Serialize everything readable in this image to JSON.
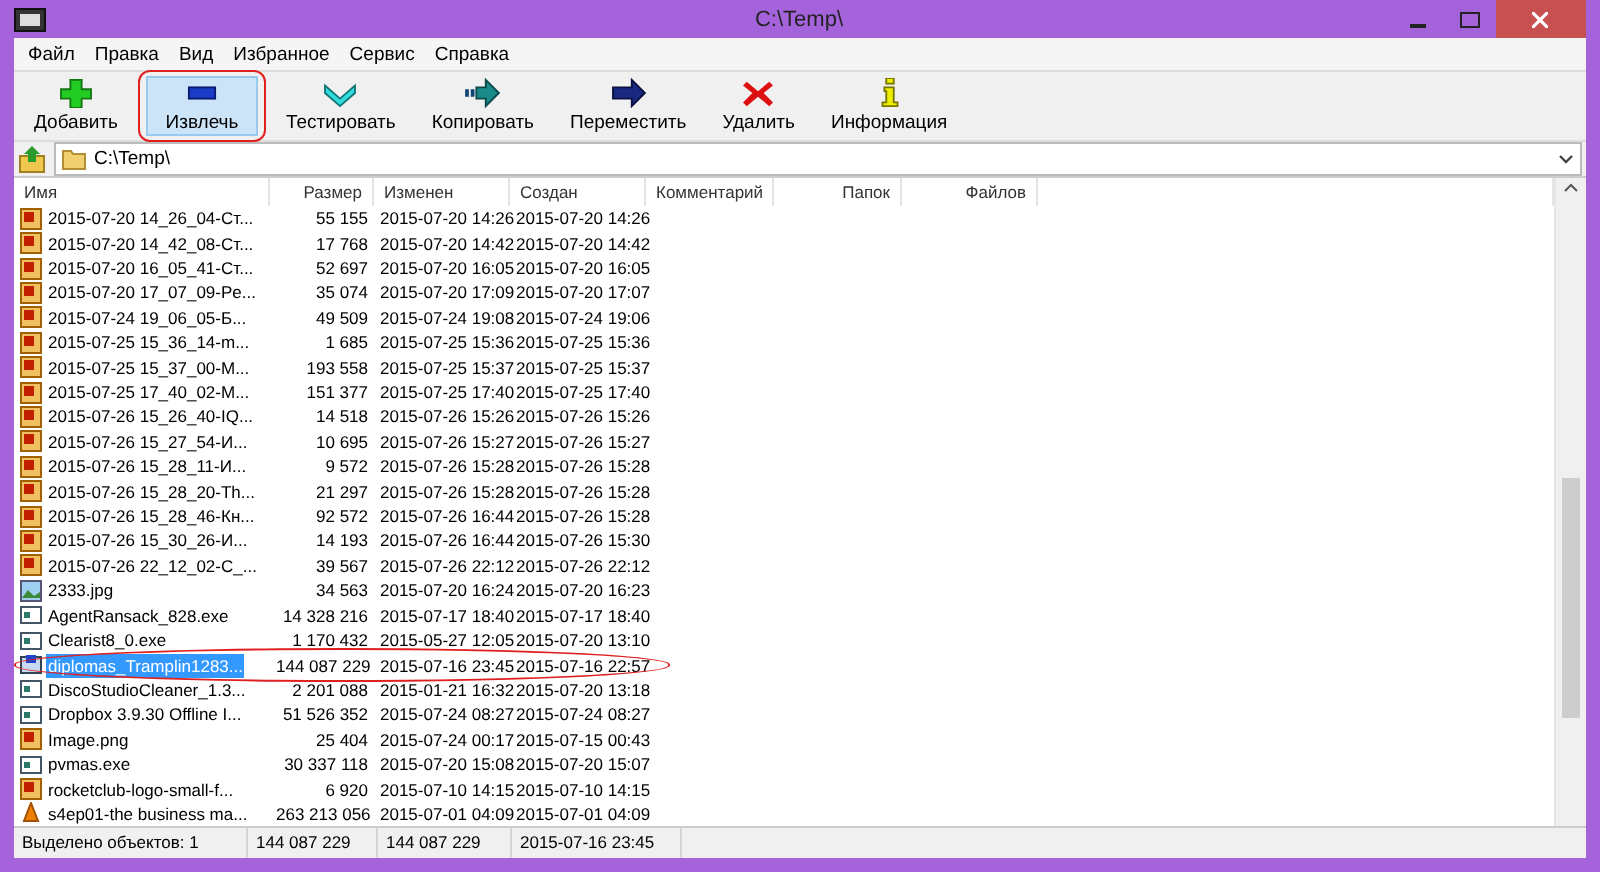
{
  "window": {
    "title": "C:\\Temp\\"
  },
  "menu": [
    "Файл",
    "Правка",
    "Вид",
    "Избранное",
    "Сервис",
    "Справка"
  ],
  "toolbar": [
    {
      "kind": "add",
      "label": "Добавить",
      "selected": false,
      "annotated": false
    },
    {
      "kind": "extract",
      "label": "Извлечь",
      "selected": true,
      "annotated": true
    },
    {
      "kind": "test",
      "label": "Тестировать",
      "selected": false,
      "annotated": false
    },
    {
      "kind": "copy",
      "label": "Копировать",
      "selected": false,
      "annotated": false
    },
    {
      "kind": "move",
      "label": "Переместить",
      "selected": false,
      "annotated": false
    },
    {
      "kind": "delete",
      "label": "Удалить",
      "selected": false,
      "annotated": false
    },
    {
      "kind": "info",
      "label": "Информация",
      "selected": false,
      "annotated": false
    }
  ],
  "address": {
    "value": "C:\\Temp\\"
  },
  "table": {
    "columns": [
      "Имя",
      "Размер",
      "Изменен",
      "Создан",
      "Комментарий",
      "Папок",
      "Файлов"
    ],
    "rows": [
      {
        "kind": "raster",
        "name": "2015-07-20 14_26_04-Ст...",
        "size": "55 155",
        "modified": "2015-07-20 14:26",
        "created": "2015-07-20 14:26",
        "selected": false,
        "annotated": false
      },
      {
        "kind": "raster",
        "name": "2015-07-20 14_42_08-Ст...",
        "size": "17 768",
        "modified": "2015-07-20 14:42",
        "created": "2015-07-20 14:42",
        "selected": false,
        "annotated": false
      },
      {
        "kind": "raster",
        "name": "2015-07-20 16_05_41-Ст...",
        "size": "52 697",
        "modified": "2015-07-20 16:05",
        "created": "2015-07-20 16:05",
        "selected": false,
        "annotated": false
      },
      {
        "kind": "raster",
        "name": "2015-07-20 17_07_09-Pe...",
        "size": "35 074",
        "modified": "2015-07-20 17:09",
        "created": "2015-07-20 17:07",
        "selected": false,
        "annotated": false
      },
      {
        "kind": "raster",
        "name": "2015-07-24 19_06_05-Б...",
        "size": "49 509",
        "modified": "2015-07-24 19:08",
        "created": "2015-07-24 19:06",
        "selected": false,
        "annotated": false
      },
      {
        "kind": "raster",
        "name": "2015-07-25 15_36_14-m...",
        "size": "1 685",
        "modified": "2015-07-25 15:36",
        "created": "2015-07-25 15:36",
        "selected": false,
        "annotated": false
      },
      {
        "kind": "raster",
        "name": "2015-07-25 15_37_00-M...",
        "size": "193 558",
        "modified": "2015-07-25 15:37",
        "created": "2015-07-25 15:37",
        "selected": false,
        "annotated": false
      },
      {
        "kind": "raster",
        "name": "2015-07-25 17_40_02-M...",
        "size": "151 377",
        "modified": "2015-07-25 17:40",
        "created": "2015-07-25 17:40",
        "selected": false,
        "annotated": false
      },
      {
        "kind": "raster",
        "name": "2015-07-26 15_26_40-IQ...",
        "size": "14 518",
        "modified": "2015-07-26 15:26",
        "created": "2015-07-26 15:26",
        "selected": false,
        "annotated": false
      },
      {
        "kind": "raster",
        "name": "2015-07-26 15_27_54-И...",
        "size": "10 695",
        "modified": "2015-07-26 15:27",
        "created": "2015-07-26 15:27",
        "selected": false,
        "annotated": false
      },
      {
        "kind": "raster",
        "name": "2015-07-26 15_28_11-И...",
        "size": "9 572",
        "modified": "2015-07-26 15:28",
        "created": "2015-07-26 15:28",
        "selected": false,
        "annotated": false
      },
      {
        "kind": "raster",
        "name": "2015-07-26 15_28_20-Th...",
        "size": "21 297",
        "modified": "2015-07-26 15:28",
        "created": "2015-07-26 15:28",
        "selected": false,
        "annotated": false
      },
      {
        "kind": "raster",
        "name": "2015-07-26 15_28_46-Кн...",
        "size": "92 572",
        "modified": "2015-07-26 16:44",
        "created": "2015-07-26 15:28",
        "selected": false,
        "annotated": false
      },
      {
        "kind": "raster",
        "name": "2015-07-26 15_30_26-И...",
        "size": "14 193",
        "modified": "2015-07-26 16:44",
        "created": "2015-07-26 15:30",
        "selected": false,
        "annotated": false
      },
      {
        "kind": "raster",
        "name": "2015-07-26 22_12_02-С_...",
        "size": "39 567",
        "modified": "2015-07-26 22:12",
        "created": "2015-07-26 22:12",
        "selected": false,
        "annotated": false
      },
      {
        "kind": "picture",
        "name": "2333.jpg",
        "size": "34 563",
        "modified": "2015-07-20 16:24",
        "created": "2015-07-20 16:23",
        "selected": false,
        "annotated": false
      },
      {
        "kind": "program",
        "name": "AgentRansack_828.exe",
        "size": "14 328 216",
        "modified": "2015-07-17 18:40",
        "created": "2015-07-17 18:40",
        "selected": false,
        "annotated": false
      },
      {
        "kind": "program",
        "name": "Clearist8_0.exe",
        "size": "1 170 432",
        "modified": "2015-05-27 12:05",
        "created": "2015-07-20 13:10",
        "selected": false,
        "annotated": false
      },
      {
        "kind": "archive",
        "name": "diplomas_Tramplin1283...",
        "size": "144 087 229",
        "modified": "2015-07-16 23:45",
        "created": "2015-07-16 22:57",
        "selected": true,
        "annotated": true
      },
      {
        "kind": "program",
        "name": "DiscoStudioCleaner_1.3...",
        "size": "2 201 088",
        "modified": "2015-01-21 16:32",
        "created": "2015-07-20 13:18",
        "selected": false,
        "annotated": false
      },
      {
        "kind": "program",
        "name": "Dropbox 3.9.30 Offline I...",
        "size": "51 526 352",
        "modified": "2015-07-24 08:27",
        "created": "2015-07-24 08:27",
        "selected": false,
        "annotated": false
      },
      {
        "kind": "raster",
        "name": "Image.png",
        "size": "25 404",
        "modified": "2015-07-24 00:17",
        "created": "2015-07-15 00:43",
        "selected": false,
        "annotated": false
      },
      {
        "kind": "program",
        "name": "pvmas.exe",
        "size": "30 337 118",
        "modified": "2015-07-20 15:08",
        "created": "2015-07-20 15:07",
        "selected": false,
        "annotated": false
      },
      {
        "kind": "raster",
        "name": "rocketclub-logo-small-f...",
        "size": "6 920",
        "modified": "2015-07-10 14:15",
        "created": "2015-07-10 14:15",
        "selected": false,
        "annotated": false
      },
      {
        "kind": "media",
        "name": "s4ep01-the business ma...",
        "size": "263 213 056",
        "modified": "2015-07-01 04:09",
        "created": "2015-07-01 04:09",
        "selected": false,
        "annotated": false
      }
    ]
  },
  "status_bar": [
    "Выделено объектов: 1",
    "144 087 229",
    "144 087 229",
    "2015-07-16 23:45"
  ]
}
